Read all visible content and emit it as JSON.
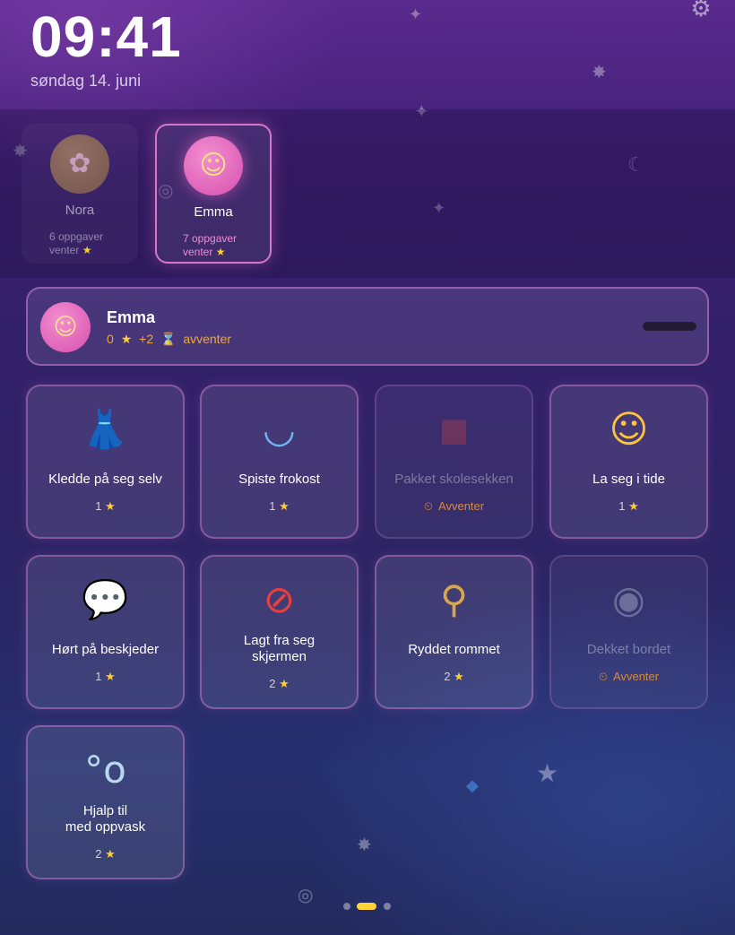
{
  "status": {
    "time": "09:41",
    "date": "søndag 14. juni"
  },
  "header": {
    "settings_icon": "gear-icon"
  },
  "profiles": [
    {
      "name": "Nora",
      "avatar": "flower-icon",
      "pending_line1": "6 oppgaver",
      "pending_line2": "venter",
      "selected": false
    },
    {
      "name": "Emma",
      "avatar": "girl-face-icon",
      "pending_line1": "7 oppgaver",
      "pending_line2": "venter",
      "selected": true
    }
  ],
  "summary": {
    "name": "Emma",
    "stars": "0",
    "pending_bonus": "+2",
    "pending_label": "avventer",
    "progress_fraction": 0
  },
  "tasks": [
    {
      "label": "Kledde på seg selv",
      "icon": "dress-icon",
      "points": "1",
      "status": "done"
    },
    {
      "label": "Spiste frokost",
      "icon": "bowl-icon",
      "points": "1",
      "status": "done"
    },
    {
      "label": "Pakket skolesekken",
      "icon": "backpack-icon",
      "status_label": "Avventer",
      "status": "pending"
    },
    {
      "label": "La seg i tide",
      "icon": "sleeping-face-icon",
      "points": "1",
      "status": "done"
    },
    {
      "label": "Hørt på beskjeder",
      "icon": "speech-bubble-icon",
      "points": "1",
      "status": "done"
    },
    {
      "label_line1": "Lagt fra seg",
      "label_line2": "skjermen",
      "icon": "no-phone-icon",
      "points": "2",
      "status": "done"
    },
    {
      "label": "Ryddet rommet",
      "icon": "broom-icon",
      "points": "2",
      "status": "done"
    },
    {
      "label": "Dekket bordet",
      "icon": "plate-cutlery-icon",
      "status_label": "Avventer",
      "status": "pending"
    },
    {
      "label_line1": "Hjalp til",
      "label_line2": "med oppvask",
      "icon": "bubbles-icon",
      "points": "2",
      "status": "done"
    }
  ],
  "pagination": {
    "page_count": 3,
    "current_page": 2
  },
  "colors": {
    "accent_pink": "#d477c8",
    "star_gold": "#ffcc33",
    "pending_orange": "#d88a3c",
    "active_dot": "#ffd23a"
  }
}
